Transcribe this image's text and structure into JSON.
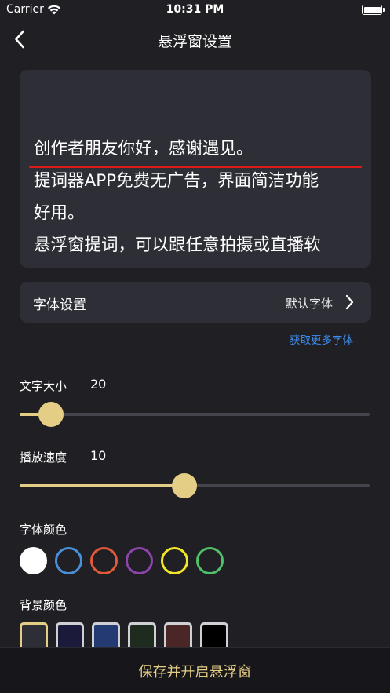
{
  "status_bar": {
    "carrier": "Carrier",
    "time": "10:31 PM"
  },
  "nav": {
    "title": "悬浮窗设置"
  },
  "preview": {
    "lines": "创作者朋友你好，感谢遇见。\n提词器APP免费无广告，界面简洁功能\n好用。\n悬浮窗提词，可以跟任意拍摄或直播软"
  },
  "font_setting": {
    "label": "字体设置",
    "value": "默认字体"
  },
  "more_fonts_link": "获取更多字体",
  "text_size": {
    "label": "文字大小",
    "value": "20",
    "fraction": 0.09
  },
  "play_speed": {
    "label": "播放速度",
    "value": "10",
    "fraction": 0.47
  },
  "font_color": {
    "label": "字体颜色",
    "options": [
      {
        "color": "#ffffff",
        "fill": "#ffffff"
      },
      {
        "color": "#4a90d9",
        "fill": "transparent"
      },
      {
        "color": "#e05a3a",
        "fill": "transparent"
      },
      {
        "color": "#8e44ad",
        "fill": "transparent"
      },
      {
        "color": "#f2e52a",
        "fill": "transparent"
      },
      {
        "color": "#4fc16a",
        "fill": "transparent"
      }
    ]
  },
  "bg_color": {
    "label": "背景颜色",
    "options": [
      {
        "fill": "#2e2f36",
        "border": "#e4cd84"
      },
      {
        "fill": "#1c1a3a",
        "border": "#cfd0d4"
      },
      {
        "fill": "#243a73",
        "border": "#cfd0d4"
      },
      {
        "fill": "#1f2b1f",
        "border": "#cfd0d4"
      },
      {
        "fill": "#4a2626",
        "border": "#cfd0d4"
      },
      {
        "fill": "#000000",
        "border": "#cfd0d4"
      }
    ]
  },
  "save_button": "保存并开启悬浮窗",
  "colors": {
    "accent": "#e4cd84",
    "link": "#3d8ef0",
    "background": "#1f1f24",
    "card": "#2e2f36"
  }
}
